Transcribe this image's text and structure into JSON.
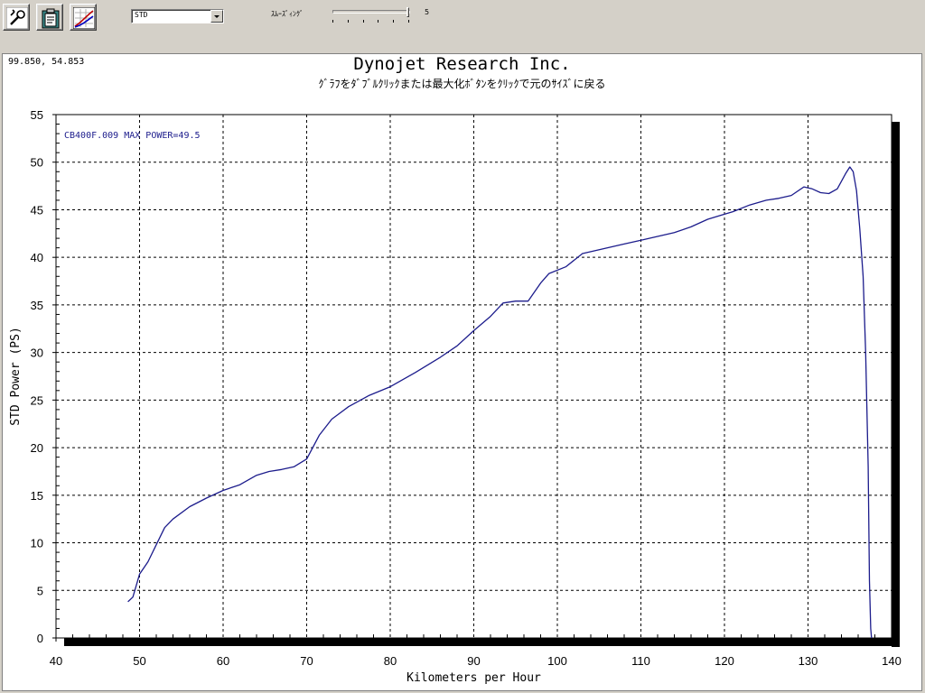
{
  "toolbar": {
    "buttons": [
      {
        "name": "tools-button",
        "icon": "wrench-icon"
      },
      {
        "name": "clipboard-button",
        "icon": "clipboard-icon"
      },
      {
        "name": "graph-button",
        "icon": "graph-icon"
      }
    ],
    "correction_select": {
      "value": "STD"
    },
    "smoothing": {
      "label": "ｽﾑｰｽﾞｨﾝｸﾞ",
      "value": "5",
      "level_fraction": 1.0
    }
  },
  "chart_panel": {
    "cursor_readout": "99.850, 54.853",
    "title": "Dynojet  Research  Inc.",
    "subtitle": "ｸﾞﾗﾌをﾀﾞﾌﾞﾙｸﾘｯｸまたは最大化ﾎﾞﾀﾝをｸﾘｯｸで元のｻｲｽﾞに戻る"
  },
  "chart_data": {
    "type": "line",
    "xlabel": "Kilometers per Hour",
    "ylabel": "STD Power (PS)",
    "xlim": [
      40,
      140
    ],
    "ylim": [
      0,
      55
    ],
    "xticks": [
      40,
      50,
      60,
      70,
      80,
      90,
      100,
      110,
      120,
      130,
      140
    ],
    "yticks": [
      0,
      5,
      10,
      15,
      20,
      25,
      30,
      35,
      40,
      45,
      50,
      55
    ],
    "grid": true,
    "legend_text": "CB400F.009  MAX POWER=49.5",
    "colors": {
      "line": "#1c1c8c",
      "grid": "#000000",
      "shadow": "#000000"
    },
    "series": [
      {
        "name": "CB400F.009",
        "x": [
          48.6,
          49.2,
          50.0,
          51.0,
          52.0,
          53.0,
          54.0,
          56.0,
          58.0,
          60.0,
          62.0,
          64.0,
          65.5,
          67.0,
          68.5,
          70.0,
          71.5,
          73.0,
          75.0,
          77.5,
          80.0,
          83.0,
          86.0,
          88.0,
          90.0,
          92.0,
          93.5,
          95.0,
          96.5,
          98.0,
          99.0,
          101.0,
          103.0,
          105.0,
          108.0,
          110.0,
          112.0,
          114.0,
          116.0,
          118.0,
          119.5,
          121.0,
          123.0,
          125.0,
          126.5,
          128.0,
          129.5,
          130.5,
          131.5,
          132.5,
          133.5,
          134.5,
          135.0,
          135.4,
          135.8,
          136.2,
          136.6,
          136.9,
          137.2,
          137.35,
          137.5,
          137.6
        ],
        "y": [
          3.8,
          4.3,
          6.7,
          8.0,
          9.8,
          11.6,
          12.5,
          13.8,
          14.7,
          15.5,
          16.1,
          17.1,
          17.5,
          17.7,
          18.0,
          18.8,
          21.3,
          23.0,
          24.3,
          25.5,
          26.4,
          27.9,
          29.5,
          30.7,
          32.3,
          33.8,
          35.2,
          35.4,
          35.4,
          37.3,
          38.3,
          39.0,
          40.4,
          40.8,
          41.4,
          41.8,
          42.2,
          42.6,
          43.2,
          44.0,
          44.4,
          44.8,
          45.5,
          46.0,
          46.2,
          46.5,
          47.4,
          47.2,
          46.8,
          46.7,
          47.2,
          48.8,
          49.5,
          49.0,
          47.0,
          43.0,
          38.0,
          30.0,
          18.0,
          6.0,
          1.0,
          0.0
        ]
      }
    ]
  }
}
